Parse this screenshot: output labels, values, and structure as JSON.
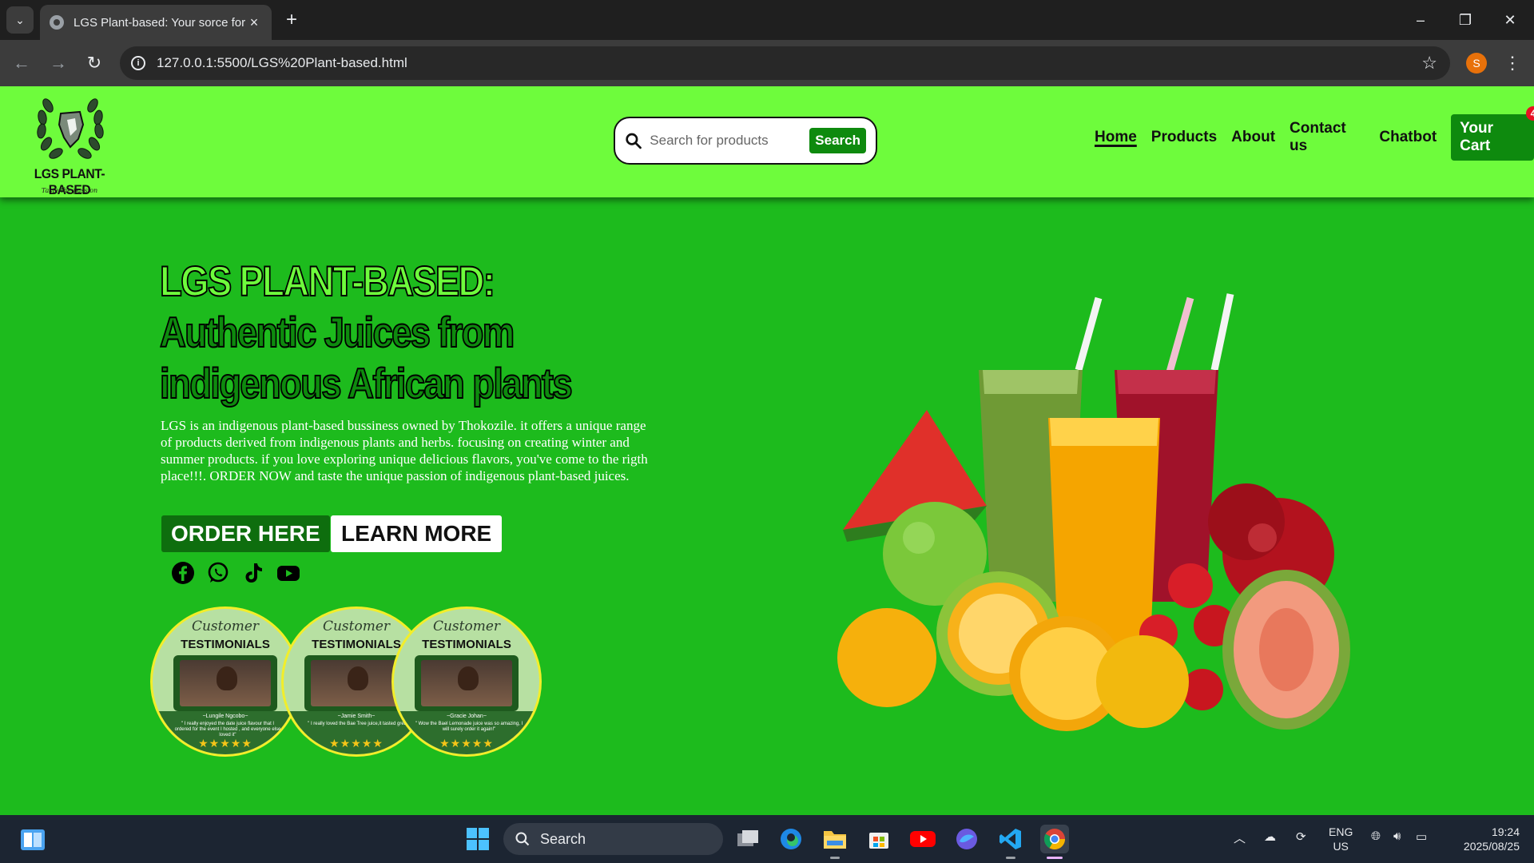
{
  "browser": {
    "tab_title": "LGS Plant-based: Your sorce for",
    "url": "127.0.0.1:5500/LGS%20Plant-based.html",
    "profile_initial": "S"
  },
  "site": {
    "logo": {
      "title": "LGS PLANT-BASED",
      "tagline": "Taste the passion"
    },
    "search": {
      "placeholder": "Search for products",
      "button": "Search"
    },
    "nav": {
      "items": [
        "Home",
        "Products",
        "About",
        "Contact us",
        "Chatbot"
      ],
      "active": "Home",
      "cart_label": "Your Cart",
      "cart_count": "4"
    },
    "hero": {
      "title_part1": "LGS PLANT-BASED:",
      "title_part2": "Authentic Juices from indigenous African plants",
      "description": "LGS is an indigenous plant-based bussiness owned by Thokozile. it offers a unique range of products derived from indigenous plants and herbs. focusing on creating winter and summer products. if you love exploring unique delicious flavors, you've come to the rigth place!!!. ORDER NOW and taste the unique passion of indigenous plant-based juices.",
      "order_button": "ORDER HERE",
      "learn_button": "LEARN MORE"
    },
    "socials": [
      "facebook-icon",
      "whatsapp-icon",
      "tiktok-icon",
      "youtube-icon"
    ],
    "testimonials": [
      {
        "heading1": "Customer",
        "heading2": "TESTIMONIALS",
        "name": "~Lungile Ngcobo~",
        "quote": "\" I really enjoyed the date juice flavour that I ordered for the event I hosted , and everyone else loved it\"",
        "stars": "★★★★★"
      },
      {
        "heading1": "Customer",
        "heading2": "TESTIMONIALS",
        "name": "~Jamie Smith~",
        "quote": "\" I really loved the Bae Tree juice,it tasted great\"",
        "stars": "★★★★★"
      },
      {
        "heading1": "Customer",
        "heading2": "TESTIMONIALS",
        "name": "~Gracie Johan~",
        "quote": "\" Wow the Bael Lemonade juice was so amazing, I will surely order it again!\"",
        "stars": "★★★★★"
      }
    ]
  },
  "taskbar": {
    "search_label": "Search",
    "lang_line1": "ENG",
    "lang_line2": "US",
    "time": "19:24",
    "date": "2025/08/25"
  },
  "colors": {
    "header_bg": "#6efc3c",
    "page_bg": "#1dbb1d",
    "accent_green": "#0e8a0e",
    "testimonial_border": "#f2ee2a"
  }
}
